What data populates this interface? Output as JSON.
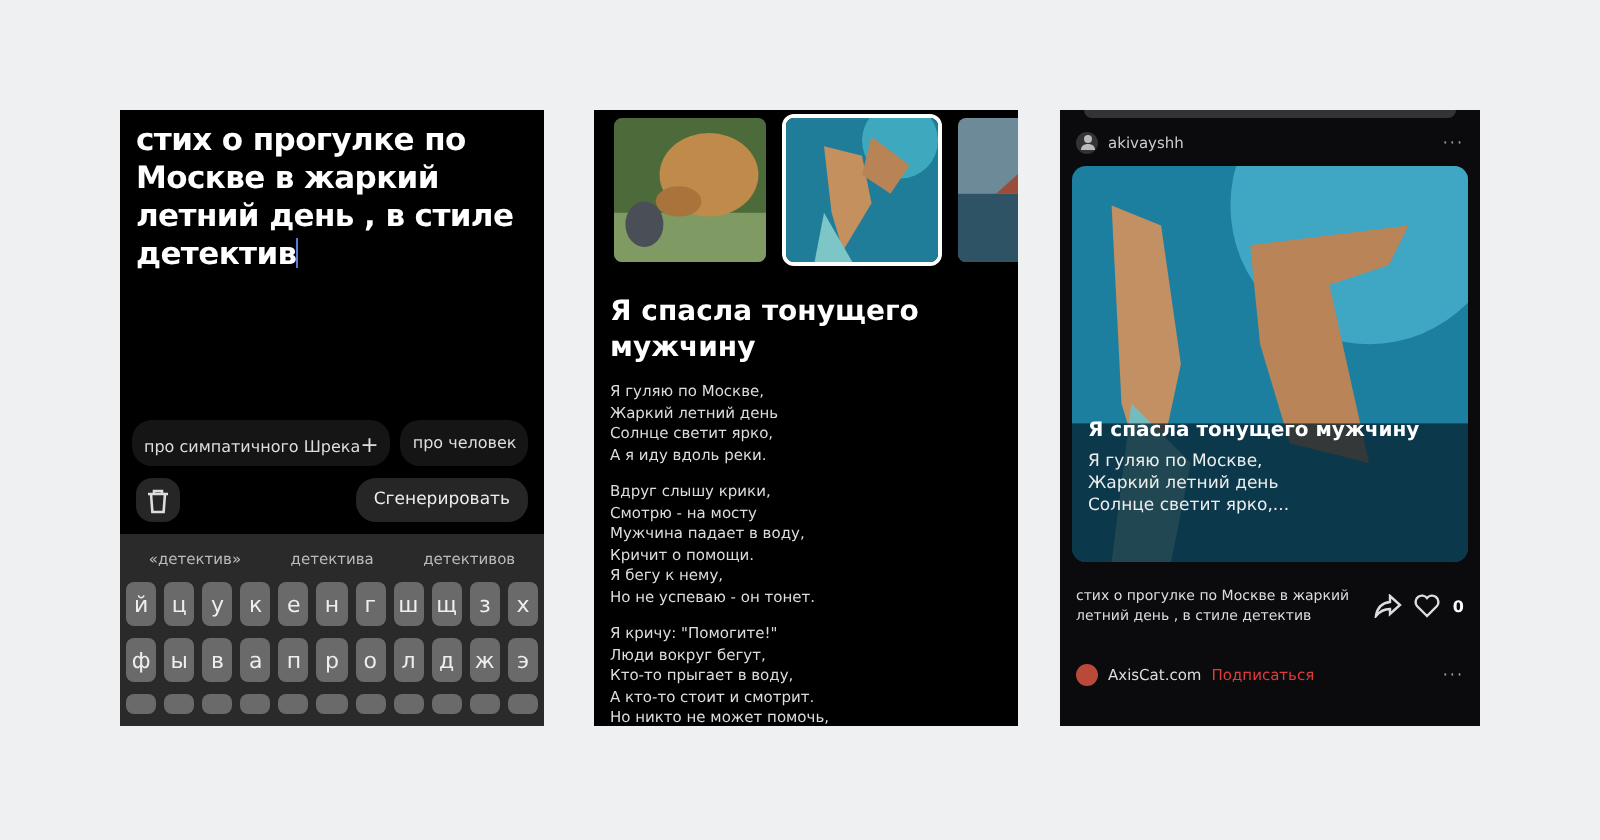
{
  "editor": {
    "prompt": "стих о прогулке по Москве в жаркий летний день , в стиле детектив",
    "chips": [
      {
        "label": "про симпатичного Шрека",
        "plus": "+"
      },
      {
        "label": "про человек"
      }
    ],
    "generate_button": "Сгенерировать",
    "suggestions": [
      "«детектив»",
      "детектива",
      "детективов"
    ],
    "keyboard_rows": [
      [
        "й",
        "ц",
        "у",
        "к",
        "е",
        "н",
        "г",
        "ш",
        "щ",
        "з",
        "х"
      ],
      [
        "ф",
        "ы",
        "в",
        "а",
        "п",
        "р",
        "о",
        "л",
        "д",
        "ж",
        "э"
      ]
    ]
  },
  "result": {
    "thumbnails": [
      {
        "kind": "picture",
        "selected": false
      },
      {
        "kind": "picture",
        "selected": true
      },
      {
        "kind": "picture",
        "selected": false
      }
    ],
    "title": "Я спасла тонущего мужчину",
    "stanzas": [
      [
        "Я гуляю по Москве,",
        "Жаркий летний день",
        "Солнце светит ярко,",
        "А я иду вдоль реки."
      ],
      [
        "Вдруг слышу крики,",
        "Смотрю - на мосту",
        "Мужчина падает в воду,",
        "Кричит о помощи.",
        "Я бегу к нему,",
        "Но не успеваю - он тонет."
      ],
      [
        "Я кричу: \"Помогите!\"",
        "Люди вокруг бегут,",
        "Кто-то прыгает в воду,",
        "А кто-то стоит и смотрит.",
        "Но никто не может помочь,"
      ]
    ]
  },
  "feed": {
    "author": "akivayshh",
    "more": "···",
    "card": {
      "title": "Я спасла тонущего мужчину",
      "excerpt": [
        "Я гуляю по Москве,",
        "Жаркий летний день",
        "Солнце светит ярко,..."
      ]
    },
    "prompt": "стих о прогулке по Москве в жаркий летний день , в стиле детектив",
    "likes": "0",
    "liked": false,
    "next_author": "AxisCat.com",
    "subscribe": "Подписаться",
    "next_more": "···"
  }
}
